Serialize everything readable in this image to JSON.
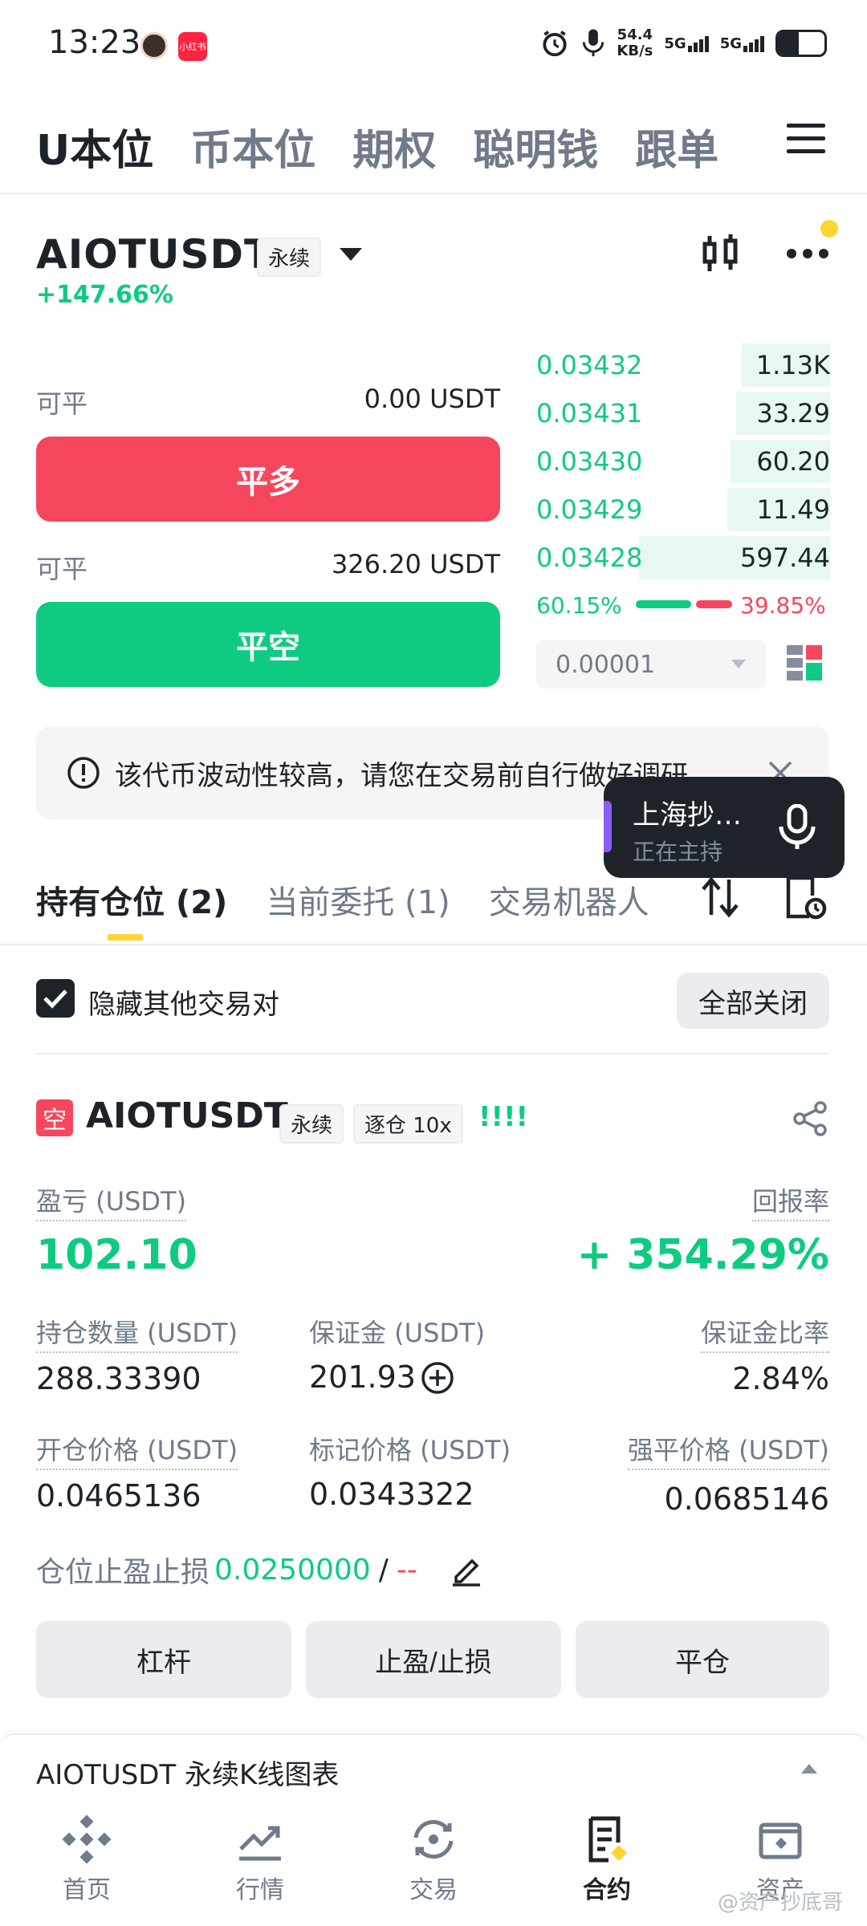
{
  "status_bar": {
    "time": "13:23",
    "net_speed_value": "54.4",
    "net_speed_unit": "KB/s",
    "signal1": "5G",
    "signal2": "5G",
    "app_badge": "小红书"
  },
  "top_tabs": [
    "U本位",
    "币本位",
    "期权",
    "聪明钱",
    "跟单"
  ],
  "pair": {
    "name": "AIOTUSDT",
    "type": "永续",
    "change": "+147.66%"
  },
  "close_panel": {
    "long_label": "可平",
    "long_value": "0.00 USDT",
    "long_button": "平多",
    "short_label": "可平",
    "short_value": "326.20 USDT",
    "short_button": "平空"
  },
  "order_book": {
    "rows": [
      {
        "price": "0.03432",
        "qty": "1.13K",
        "depth": 0.3
      },
      {
        "price": "0.03431",
        "qty": "33.29",
        "depth": 0.32
      },
      {
        "price": "0.03430",
        "qty": "60.20",
        "depth": 0.34
      },
      {
        "price": "0.03429",
        "qty": "11.49",
        "depth": 0.35
      },
      {
        "price": "0.03428",
        "qty": "597.44",
        "depth": 0.65
      }
    ],
    "buy_ratio": "60.15%",
    "sell_ratio": "39.85%",
    "buy_fraction": 0.6015,
    "step": "0.00001"
  },
  "warning_text": "该代币波动性较高，请您在交易前自行做好调研",
  "live": {
    "title": "上海抄…",
    "subtitle": "正在主持"
  },
  "position_tabs": [
    "持有仓位 (2)",
    "当前委托 (1)",
    "交易机器人"
  ],
  "hide_pairs_label": "隐藏其他交易对",
  "close_all_label": "全部关闭",
  "position": {
    "side_badge": "空",
    "name": "AIOTUSDT",
    "type": "永续",
    "margin_mode": "逐仓 10x",
    "bars": "!!!!",
    "pnl_label": "盈亏 (USDT)",
    "pnl_value": "102.10",
    "roe_label": "回报率",
    "roe_value": "+ 354.29%",
    "size_label": "持仓数量 (USDT)",
    "size_value": "288.33390",
    "margin_label": "保证金 (USDT)",
    "margin_value": "201.93",
    "margin_ratio_label": "保证金比率",
    "margin_ratio_value": "2.84%",
    "entry_label": "开仓价格 (USDT)",
    "entry_value": "0.0465136",
    "mark_label": "标记价格 (USDT)",
    "mark_value": "0.0343322",
    "liq_label": "强平价格 (USDT)",
    "liq_value": "0.0685146",
    "tpsl_label": "仓位止盈止损",
    "tp_value": "0.0250000",
    "sep": "/",
    "sl_value": "--"
  },
  "action_buttons": [
    "杠杆",
    "止盈/止损",
    "平仓"
  ],
  "kline_label": "AIOTUSDT 永续K线图表",
  "nav": [
    "首页",
    "行情",
    "交易",
    "合约",
    "资产"
  ],
  "watermark": "@资产抄底哥",
  "colors": {
    "green": "#0ecb81",
    "red": "#f6465d",
    "yellow": "#fcd535",
    "text": "#1e2329",
    "grey": "#707a8a"
  }
}
